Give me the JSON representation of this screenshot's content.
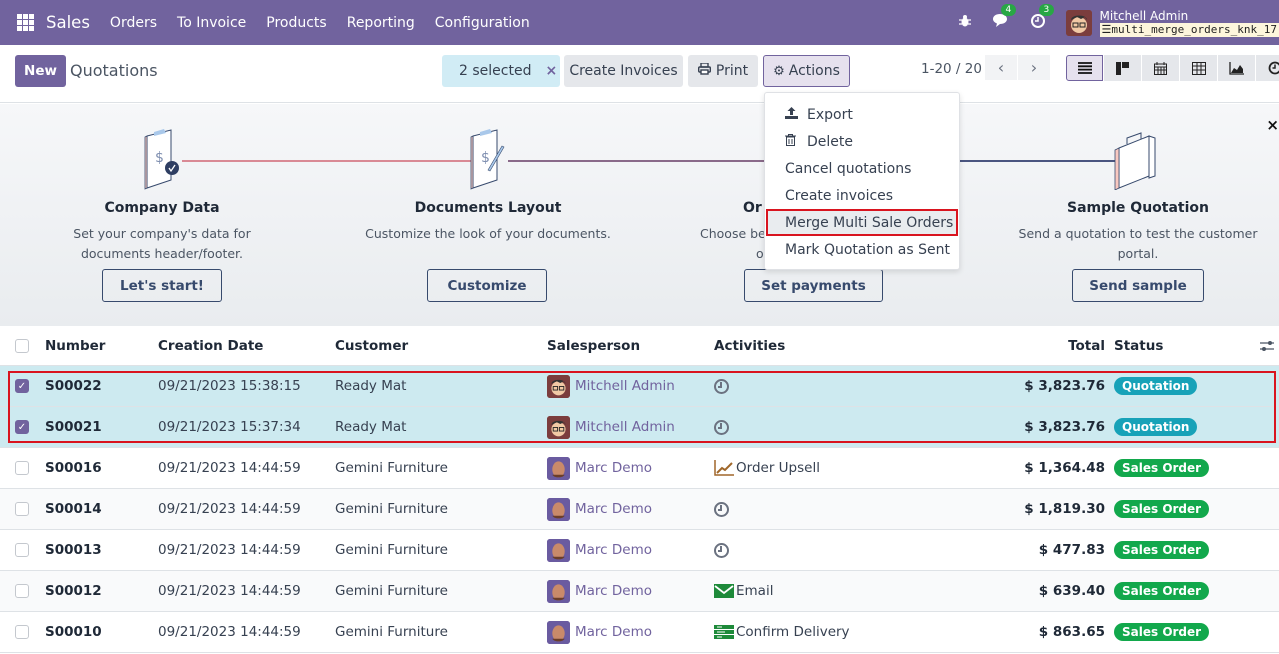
{
  "navbar": {
    "app_name": "Sales",
    "menu": [
      "Orders",
      "To Invoice",
      "Products",
      "Reporting",
      "Configuration"
    ],
    "messages_count": "4",
    "activities_count": "3",
    "user_name": "Mitchell Admin",
    "database": "multi_merge_orders_knk_17",
    "icons": [
      "apps-grid-icon",
      "bug-icon",
      "chat-icon",
      "clock-icon",
      "user-avatar"
    ]
  },
  "control_panel": {
    "new_label": "New",
    "title": "Quotations",
    "selected_label": "2 selected",
    "clear_selection": "×",
    "create_invoices_label": "Create Invoices",
    "print_label": "Print",
    "actions_label": "Actions",
    "pager_value": "1-20 / 20",
    "views": [
      "list",
      "kanban",
      "calendar",
      "pivot",
      "graph",
      "activity"
    ],
    "active_view": "list"
  },
  "actions_menu": {
    "items": [
      {
        "label": "Export",
        "icon": "upload-icon"
      },
      {
        "label": "Delete",
        "icon": "trash-icon"
      },
      {
        "label": "Cancel quotations",
        "icon": ""
      },
      {
        "label": "Create invoices",
        "icon": ""
      },
      {
        "label": "Merge Multi Sale Orders",
        "icon": "",
        "highlighted": true
      },
      {
        "label": "Mark Quotation as Sent",
        "icon": ""
      }
    ]
  },
  "onboarding": {
    "steps": [
      {
        "title": "Company Data",
        "description": "Set your company's data for documents header/footer.",
        "button": "Let's start!"
      },
      {
        "title": "Documents Layout",
        "description": "Customize the look of your documents.",
        "button": "Customize"
      },
      {
        "title": "Or",
        "description": "Choose be",
        "description2": "o",
        "button": "Set payments"
      },
      {
        "title": "Sample Quotation",
        "description": "Send a quotation to test the customer portal.",
        "button": "Send sample"
      }
    ],
    "close_label": "×"
  },
  "table": {
    "columns": [
      "Number",
      "Creation Date",
      "Customer",
      "Salesperson",
      "Activities",
      "Total",
      "Status"
    ],
    "rows": [
      {
        "number": "S00022",
        "date": "09/21/2023 15:38:15",
        "customer": "Ready Mat",
        "salesperson": "Mitchell Admin",
        "activity": "",
        "activity_icon": "clock-icon",
        "total": "$ 3,823.76",
        "status": "Quotation",
        "selected": true
      },
      {
        "number": "S00021",
        "date": "09/21/2023 15:37:34",
        "customer": "Ready Mat",
        "salesperson": "Mitchell Admin",
        "activity": "",
        "activity_icon": "clock-icon",
        "total": "$ 3,823.76",
        "status": "Quotation",
        "selected": true
      },
      {
        "number": "S00016",
        "date": "09/21/2023 14:44:59",
        "customer": "Gemini Furniture",
        "salesperson": "Marc Demo",
        "activity": "Order Upsell",
        "activity_icon": "upsell-chart-icon",
        "total": "$ 1,364.48",
        "status": "Sales Order",
        "selected": false
      },
      {
        "number": "S00014",
        "date": "09/21/2023 14:44:59",
        "customer": "Gemini Furniture",
        "salesperson": "Marc Demo",
        "activity": "",
        "activity_icon": "clock-icon",
        "total": "$ 1,819.30",
        "status": "Sales Order",
        "selected": false
      },
      {
        "number": "S00013",
        "date": "09/21/2023 14:44:59",
        "customer": "Gemini Furniture",
        "salesperson": "Marc Demo",
        "activity": "",
        "activity_icon": "clock-icon",
        "total": "$ 477.83",
        "status": "Sales Order",
        "selected": false
      },
      {
        "number": "S00012",
        "date": "09/21/2023 14:44:59",
        "customer": "Gemini Furniture",
        "salesperson": "Marc Demo",
        "activity": "Email",
        "activity_icon": "envelope-icon",
        "total": "$ 639.40",
        "status": "Sales Order",
        "selected": false
      },
      {
        "number": "S00010",
        "date": "09/21/2023 14:44:59",
        "customer": "Gemini Furniture",
        "salesperson": "Marc Demo",
        "activity": "Confirm Delivery",
        "activity_icon": "delivery-icon",
        "total": "$ 863.65",
        "status": "Sales Order",
        "selected": false
      }
    ]
  },
  "colors": {
    "brand": "#71639e",
    "quotation": "#17a2b8",
    "sales_order": "#12a84c",
    "highlight_frame": "#d9141f",
    "selected_row": "#cdeaf0"
  }
}
